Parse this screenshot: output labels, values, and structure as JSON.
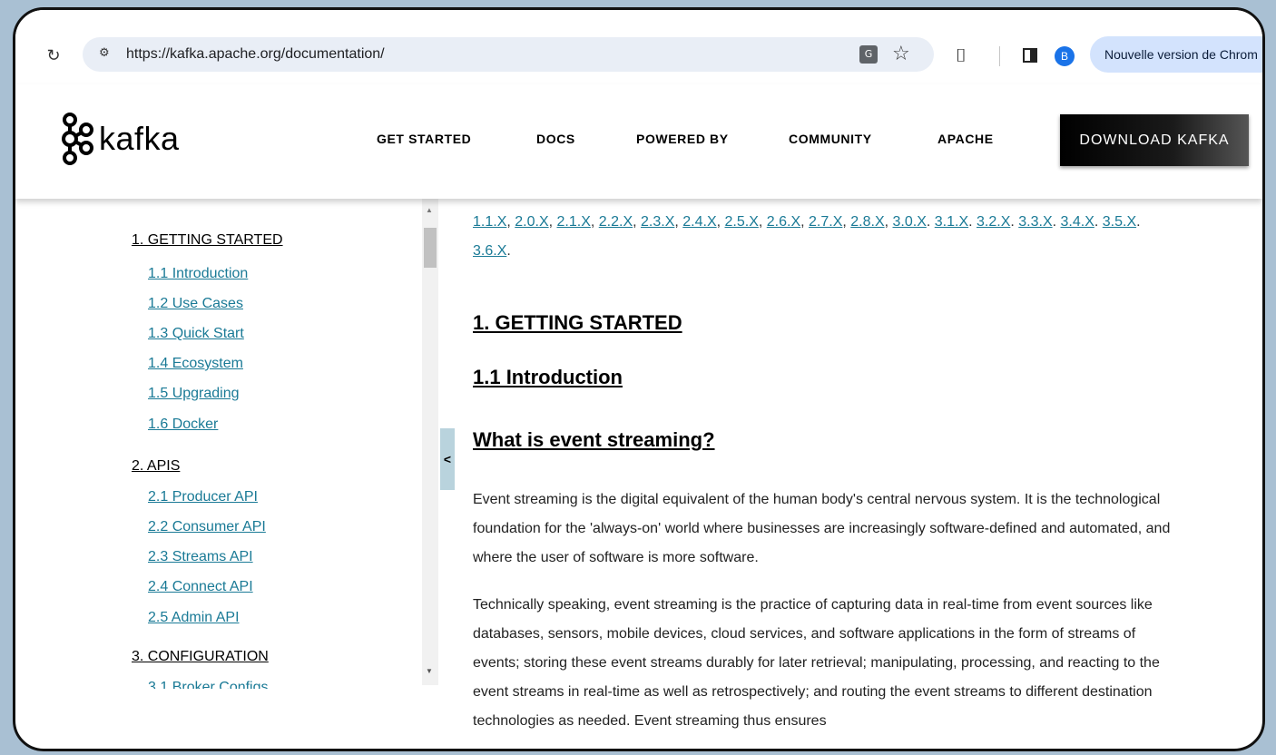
{
  "browser": {
    "url": "https://kafka.apache.org/documentation/",
    "avatar_letter": "B",
    "update_label": "Nouvelle version de Chrom"
  },
  "site": {
    "logo_text": "kafka",
    "nav": [
      "GET STARTED",
      "DOCS",
      "POWERED BY",
      "COMMUNITY",
      "APACHE"
    ],
    "download_label": "DOWNLOAD KAFKA"
  },
  "docnav": {
    "sections": [
      {
        "label": "1. GETTING STARTED",
        "items": [
          "1.1 Introduction",
          "1.2 Use Cases",
          "1.3 Quick Start",
          "1.4 Ecosystem",
          "1.5 Upgrading",
          "1.6 Docker"
        ]
      },
      {
        "label": "2. APIS",
        "items": [
          "2.1 Producer API",
          "2.2 Consumer API",
          "2.3 Streams API",
          "2.4 Connect API",
          "2.5 Admin API"
        ]
      },
      {
        "label": "3. CONFIGURATION",
        "items": [
          "3.1 Broker Configs"
        ]
      }
    ],
    "collapse_label": "<"
  },
  "content": {
    "versions": [
      "1.1.X",
      "2.0.X",
      "2.1.X",
      "2.2.X",
      "2.3.X",
      "2.4.X",
      "2.5.X",
      "2.6.X",
      "2.7.X",
      "2.8.X",
      "3.0.X",
      "3.1.X",
      "3.2.X",
      "3.3.X",
      "3.4.X",
      "3.5.X",
      "3.6.X"
    ],
    "heading_main": "1. GETTING STARTED",
    "heading_intro": "1.1 Introduction",
    "heading_what": "What is event streaming?",
    "para1": "Event streaming is the digital equivalent of the human body's central nervous system. It is the technological foundation for the 'always-on' world where businesses are increasingly software-defined and automated, and where the user of software is more software.",
    "para2": "Technically speaking, event streaming is the practice of capturing data in real-time from event sources like databases, sensors, mobile devices, cloud services, and software applications in the form of streams of events; storing these event streams durably for later retrieval; manipulating, processing, and reacting to the event streams in real-time as well as retrospectively; and routing the event streams to different destination technologies as needed. Event streaming thus ensures"
  }
}
